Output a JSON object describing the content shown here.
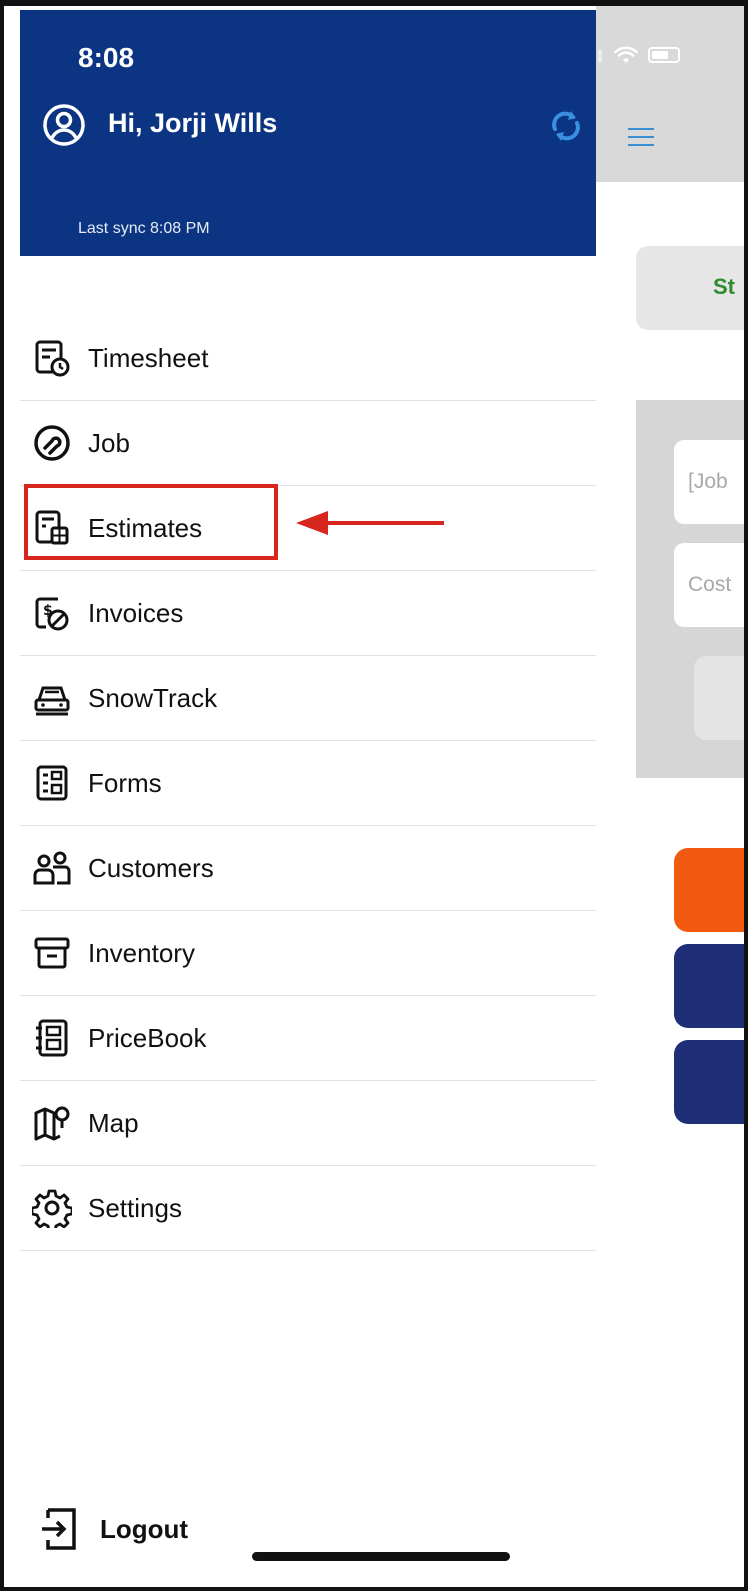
{
  "status_bar": {
    "time": "8:08"
  },
  "drawer": {
    "greeting": "Hi, Jorji Wills",
    "last_sync": "Last sync 8:08 PM",
    "items": [
      {
        "label": "Timesheet",
        "icon": "timesheet-icon"
      },
      {
        "label": "Job",
        "icon": "job-icon"
      },
      {
        "label": "Estimates",
        "icon": "estimates-icon"
      },
      {
        "label": "Invoices",
        "icon": "invoices-icon"
      },
      {
        "label": "SnowTrack",
        "icon": "snowtrack-icon"
      },
      {
        "label": "Forms",
        "icon": "forms-icon"
      },
      {
        "label": "Customers",
        "icon": "customers-icon"
      },
      {
        "label": "Inventory",
        "icon": "inventory-icon"
      },
      {
        "label": "PriceBook",
        "icon": "pricebook-icon"
      },
      {
        "label": "Map",
        "icon": "map-icon"
      },
      {
        "label": "Settings",
        "icon": "settings-icon"
      }
    ],
    "logout_label": "Logout"
  },
  "background": {
    "card_text": "St",
    "job_placeholder": "[Job",
    "cost_placeholder": "Cost"
  },
  "annotation": {
    "highlighted_item": "Estimates"
  },
  "colors": {
    "header": "#0b3482",
    "accent_orange": "#f25a12",
    "accent_navy": "#1e2f78",
    "highlight": "#d7261e"
  }
}
